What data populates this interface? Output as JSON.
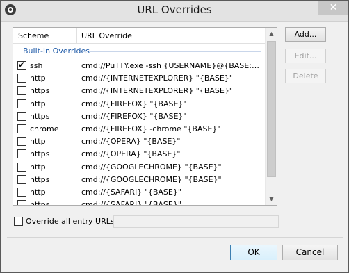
{
  "window": {
    "title": "URL Overrides",
    "close_glyph": "✕"
  },
  "table": {
    "col_scheme": "Scheme",
    "col_override": "URL Override",
    "group_label": "Built-In Overrides",
    "rows": [
      {
        "checked": true,
        "scheme": "ssh",
        "override": "cmd://PuTTY.exe -ssh {USERNAME}@{BASE:RMVSCM}"
      },
      {
        "checked": false,
        "scheme": "http",
        "override": "cmd://{INTERNETEXPLORER} \"{BASE}\""
      },
      {
        "checked": false,
        "scheme": "https",
        "override": "cmd://{INTERNETEXPLORER} \"{BASE}\""
      },
      {
        "checked": false,
        "scheme": "http",
        "override": "cmd://{FIREFOX} \"{BASE}\""
      },
      {
        "checked": false,
        "scheme": "https",
        "override": "cmd://{FIREFOX} \"{BASE}\""
      },
      {
        "checked": false,
        "scheme": "chrome",
        "override": "cmd://{FIREFOX} -chrome \"{BASE}\""
      },
      {
        "checked": false,
        "scheme": "http",
        "override": "cmd://{OPERA} \"{BASE}\""
      },
      {
        "checked": false,
        "scheme": "https",
        "override": "cmd://{OPERA} \"{BASE}\""
      },
      {
        "checked": false,
        "scheme": "http",
        "override": "cmd://{GOOGLECHROME} \"{BASE}\""
      },
      {
        "checked": false,
        "scheme": "https",
        "override": "cmd://{GOOGLECHROME} \"{BASE}\""
      },
      {
        "checked": false,
        "scheme": "http",
        "override": "cmd://{SAFARI} \"{BASE}\""
      },
      {
        "checked": false,
        "scheme": "https",
        "override": "cmd://{SAFARI} \"{BASE}\""
      }
    ]
  },
  "buttons": {
    "add": "Add...",
    "edit": "Edit...",
    "delete": "Delete",
    "ok": "OK",
    "cancel": "Cancel"
  },
  "override_all": {
    "label": "Override all entry URLs:",
    "value": ""
  }
}
